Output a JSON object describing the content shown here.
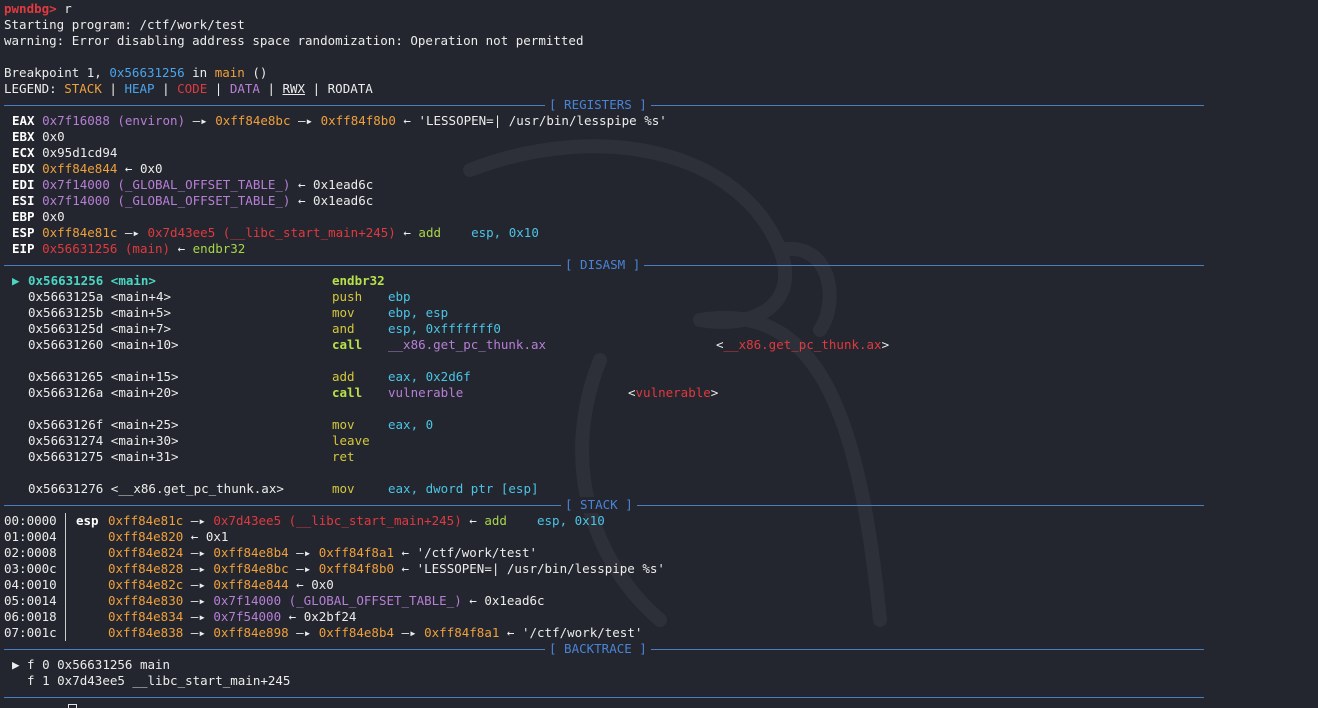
{
  "prompt": "pwndbg>",
  "command": "r",
  "starting": "Starting program: /ctf/work/test",
  "warning": "warning: Error disabling address space randomization: Operation not permitted",
  "breakpoint": {
    "prefix": "Breakpoint 1, ",
    "addr": "0x56631256",
    "in": " in ",
    "func": "main",
    "args": " ()"
  },
  "legend": {
    "label": "LEGEND: ",
    "stack": "STACK",
    "heap": "HEAP",
    "code": "CODE",
    "data": "DATA",
    "rwx": "RWX",
    "rodata": "RODATA",
    "sep": " | "
  },
  "banners": {
    "registers": "[ REGISTERS ]",
    "disasm": "[ DISASM ]",
    "stack": "[ STACK ]",
    "backtrace": "[ BACKTRACE ]"
  },
  "registers": [
    {
      "name": "EAX",
      "val": "0x7f16088",
      "sym": " (environ)",
      "c1": " —▸ ",
      "p1": "0xff84e8bc",
      "c2": " —▸ ",
      "p2": "0xff84f8b0",
      "c3": " ← ",
      "tail": "'LESSOPEN=| /usr/bin/lesspipe %s'"
    },
    {
      "name": "EBX",
      "val": "0x0"
    },
    {
      "name": "ECX",
      "val": "0x95d1cd94"
    },
    {
      "name": "EDX",
      "val": "0xff84e844",
      "c3": " ← ",
      "tail": "0x0"
    },
    {
      "name": "EDI",
      "val": "0x7f14000",
      "sym": " (_GLOBAL_OFFSET_TABLE_)",
      "c3": " ← ",
      "tail": "0x1ead6c"
    },
    {
      "name": "ESI",
      "val": "0x7f14000",
      "sym": " (_GLOBAL_OFFSET_TABLE_)",
      "c3": " ← ",
      "tail": "0x1ead6c"
    },
    {
      "name": "EBP",
      "val": "0x0"
    },
    {
      "name": "ESP",
      "val": "0xff84e81c",
      "c1": " —▸ ",
      "p1": "0x7d43ee5",
      "p1sym": " (__libc_start_main+245)",
      "c3": " ← ",
      "ins": "add",
      "ops": "esp, ",
      "imm": "0x10"
    },
    {
      "name": "EIP",
      "val": "0x56631256",
      "sym": " (main)",
      "c3": " ← ",
      "ins": "endbr32"
    }
  ],
  "disasm": [
    {
      "addr": "0x56631256",
      "label": "<main>",
      "mn": "endbr32",
      "ops": "",
      "current": true,
      "marker": "▶"
    },
    {
      "addr": "0x5663125a",
      "label": "<main+4>",
      "mn": "push",
      "ops": "ebp"
    },
    {
      "addr": "0x5663125b",
      "label": "<main+5>",
      "mn": "mov",
      "ops": "ebp, esp"
    },
    {
      "addr": "0x5663125d",
      "label": "<main+7>",
      "mn": "and",
      "ops": "esp, 0xfffffff0"
    },
    {
      "addr": "0x56631260",
      "label": "<main+10>",
      "mn": "call",
      "ops": "__x86.get_pc_thunk.ax",
      "target": "__x86.get_pc_thunk.ax",
      "call": true
    },
    {
      "addr": "0x56631265",
      "label": "<main+15>",
      "mn": "add",
      "ops": "eax, 0x2d6f"
    },
    {
      "addr": "0x5663126a",
      "label": "<main+20>",
      "mn": "call",
      "ops": "vulnerable",
      "target": "vulnerable",
      "call": true
    },
    {
      "addr": "0x5663126f",
      "label": "<main+25>",
      "mn": "mov",
      "ops": "eax, 0"
    },
    {
      "addr": "0x56631274",
      "label": "<main+30>",
      "mn": "leave",
      "ops": ""
    },
    {
      "addr": "0x56631275",
      "label": "<main+31>",
      "mn": "ret",
      "ops": ""
    },
    {
      "addr": "0x56631276",
      "label": "<__x86.get_pc_thunk.ax>",
      "mn": "mov",
      "ops": "eax, dword ptr [esp]"
    }
  ],
  "stack": [
    {
      "idx": "00:0000",
      "reg": "esp",
      "addr": "0xff84e81c",
      "a1": " —▸ ",
      "v1": "0x7d43ee5",
      "v1sym": " (__libc_start_main+245)",
      "a2": " ← ",
      "ins": "add",
      "ops": "esp, ",
      "imm": "0x10"
    },
    {
      "idx": "01:0004",
      "reg": "",
      "addr": "0xff84e820",
      "a2": " ← ",
      "tail": "0x1"
    },
    {
      "idx": "02:0008",
      "reg": "",
      "addr": "0xff84e824",
      "a1": " —▸ ",
      "v1": "0xff84e8b4",
      "a1b": " —▸ ",
      "v2": "0xff84f8a1",
      "a2": " ← ",
      "tail": "'/ctf/work/test'"
    },
    {
      "idx": "03:000c",
      "reg": "",
      "addr": "0xff84e828",
      "a1": " —▸ ",
      "v1": "0xff84e8bc",
      "a1b": " —▸ ",
      "v2": "0xff84f8b0",
      "a2": " ← ",
      "tail": "'LESSOPEN=| /usr/bin/lesspipe %s'"
    },
    {
      "idx": "04:0010",
      "reg": "",
      "addr": "0xff84e82c",
      "a1": " —▸ ",
      "v1": "0xff84e844",
      "a2": " ← ",
      "tail": "0x0"
    },
    {
      "idx": "05:0014",
      "reg": "",
      "addr": "0xff84e830",
      "a1": " —▸ ",
      "v1p": "0x7f14000",
      "v1psym": " (_GLOBAL_OFFSET_TABLE_)",
      "a2": " ← ",
      "tail": "0x1ead6c"
    },
    {
      "idx": "06:0018",
      "reg": "",
      "addr": "0xff84e834",
      "a1": " —▸ ",
      "v1p": "0x7f54000",
      "a2": " ← ",
      "tail": "0x2bf24"
    },
    {
      "idx": "07:001c",
      "reg": "",
      "addr": "0xff84e838",
      "a1": " —▸ ",
      "v1": "0xff84e898",
      "a1b": " —▸ ",
      "v2": "0xff84e8b4",
      "a1c": " —▸ ",
      "v3": "0xff84f8a1",
      "a2": " ← ",
      "tail": "'/ctf/work/test'"
    }
  ],
  "backtrace": [
    {
      "marker": "▶",
      "text": " f 0 0x56631256 main"
    },
    {
      "marker": " ",
      "text": " f 1 0x7d43ee5 __libc_start_main+245"
    }
  ],
  "colors": {
    "background": "#23262e",
    "separator": "#4a7cc8",
    "stack": "#f0a03c",
    "heap": "#4aa4ee",
    "code": "#e0393f",
    "data": "#b77fd6"
  }
}
